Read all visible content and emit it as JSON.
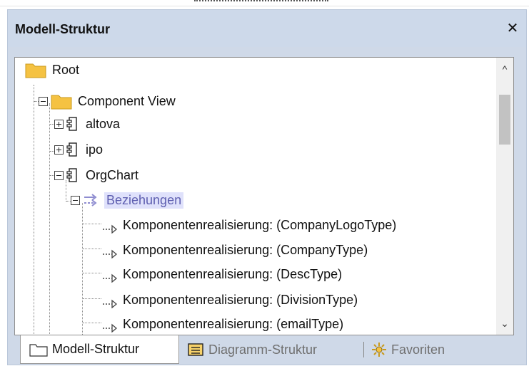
{
  "panel": {
    "title": "Modell-Struktur",
    "close_glyph": "✕"
  },
  "tree": {
    "root": "Root",
    "component_view": "Component View",
    "packages": [
      "altova",
      "ipo",
      "OrgChart"
    ],
    "relations_folder": "Beziehungen",
    "realizations": [
      "Komponentenrealisierung:  (CompanyLogoType)",
      "Komponentenrealisierung:  (CompanyType)",
      "Komponentenrealisierung:  (DescType)",
      "Komponentenrealisierung:  (DivisionType)",
      "Komponentenrealisierung:  (emailType)"
    ]
  },
  "scrollbar": {
    "up_glyph": "^",
    "down_glyph": "⌄"
  },
  "tabs": [
    {
      "label": "Modell-Struktur",
      "icon": "folder-icon",
      "active": true
    },
    {
      "label": "Diagramm-Struktur",
      "icon": "diagram-tree-icon",
      "active": false
    },
    {
      "label": "Favoriten",
      "icon": "favorites-icon",
      "active": false
    }
  ],
  "colors": {
    "panel_header": "#cdd9ea",
    "folder": "#f5c242",
    "selection": "#dfe1fb",
    "selection_text": "#5e5fb0",
    "arrow_accent": "#9b98d8"
  }
}
